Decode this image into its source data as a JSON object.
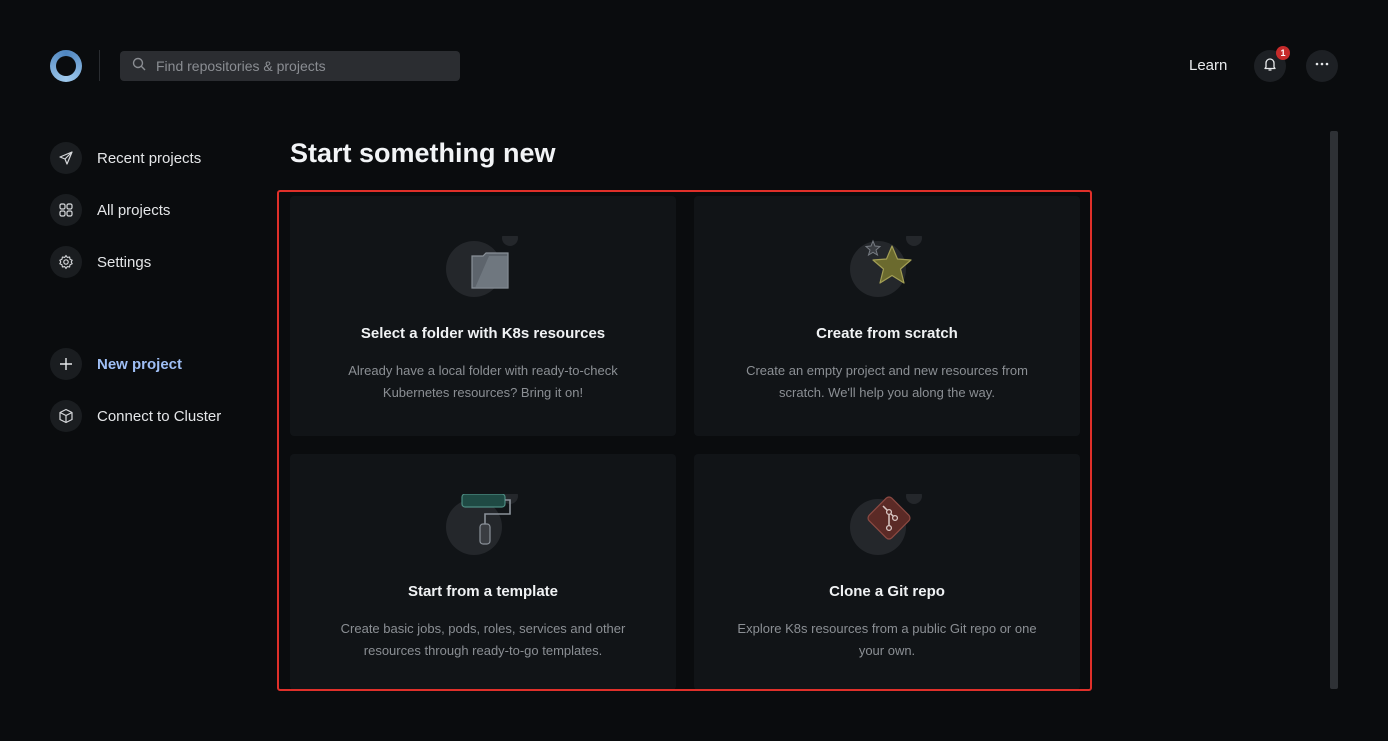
{
  "header": {
    "search_placeholder": "Find repositories & projects",
    "learn_label": "Learn",
    "notification_count": "1"
  },
  "sidebar": {
    "items": [
      {
        "label": "Recent projects",
        "icon": "paper-plane-icon"
      },
      {
        "label": "All projects",
        "icon": "grid-icon"
      },
      {
        "label": "Settings",
        "icon": "gear-icon"
      },
      {
        "label": "New project",
        "icon": "plus-icon"
      },
      {
        "label": "Connect to Cluster",
        "icon": "cube-icon"
      }
    ]
  },
  "main": {
    "title": "Start something new",
    "cards": [
      {
        "title": "Select a folder with K8s resources",
        "description": "Already have a local folder with ready-to-check Kubernetes resources? Bring it on!",
        "icon": "folder-icon"
      },
      {
        "title": "Create from scratch",
        "description": "Create an empty project and new resources from scratch. We'll help you along the way.",
        "icon": "star-icon"
      },
      {
        "title": "Start from a template",
        "description": "Create basic jobs, pods, roles, services and other resources through ready-to-go templates.",
        "icon": "paint-roller-icon"
      },
      {
        "title": "Clone a Git repo",
        "description": "Explore K8s resources from a public Git repo or one your own.",
        "icon": "git-icon"
      }
    ]
  },
  "colors": {
    "background": "#0a0c0e",
    "card": "#111417",
    "accent": "#9fbff5",
    "highlight": "#e0302a",
    "badge": "#c62b2b"
  }
}
